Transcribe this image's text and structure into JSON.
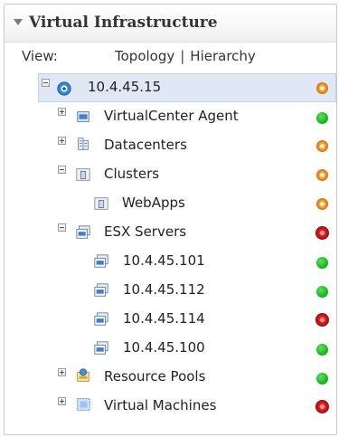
{
  "panel": {
    "title": "Virtual Infrastructure"
  },
  "view": {
    "label": "View:",
    "topology": "Topology",
    "separator": "|",
    "hierarchy": "Hierarchy"
  },
  "tree": {
    "root": {
      "label": "10.4.45.15",
      "status": "orange"
    },
    "vc_agent": {
      "label": "VirtualCenter Agent",
      "status": "green"
    },
    "datacenters": {
      "label": "Datacenters",
      "status": "orange"
    },
    "clusters": {
      "label": "Clusters",
      "status": "orange"
    },
    "webapps": {
      "label": "WebApps",
      "status": "orange"
    },
    "esx_servers": {
      "label": "ESX Servers",
      "status": "red"
    },
    "host1": {
      "label": "10.4.45.101",
      "status": "green"
    },
    "host2": {
      "label": "10.4.45.112",
      "status": "green"
    },
    "host3": {
      "label": "10.4.45.114",
      "status": "red"
    },
    "host4": {
      "label": "10.4.45.100",
      "status": "green"
    },
    "resource_pools": {
      "label": "Resource Pools",
      "status": "green"
    },
    "virtual_machines": {
      "label": "Virtual Machines",
      "status": "red"
    }
  }
}
